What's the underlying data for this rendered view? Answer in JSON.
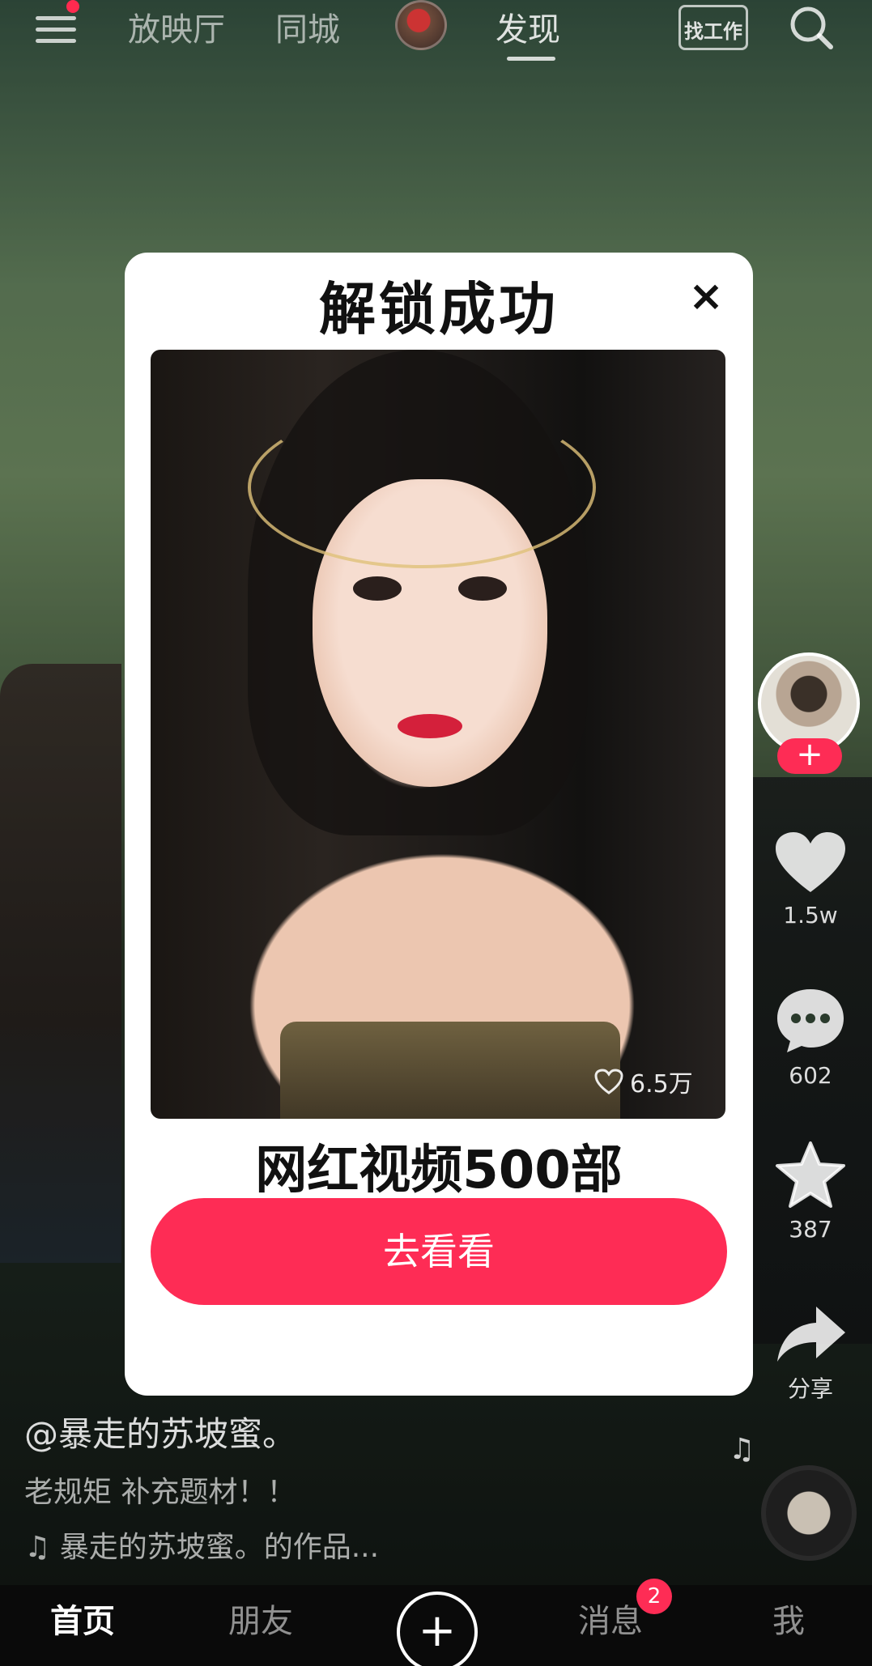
{
  "top_nav": {
    "tabs": [
      "放映厅",
      "同城",
      "发现"
    ],
    "active_tab": "发现",
    "job_label": "找工作"
  },
  "sidebar": {
    "like_count": "1.5w",
    "comment_count": "602",
    "favorite_count": "387",
    "share_label": "分享"
  },
  "video": {
    "author": "@暴走的苏坡蜜。",
    "description": "老规矩 补充题材！！",
    "music": "暴走的苏坡蜜。的作品..."
  },
  "modal": {
    "title": "解锁成功",
    "close_label": "×",
    "preview_likes": "6.5万",
    "offer_title": "网红视频500部",
    "cta_label": "去看看"
  },
  "tabbar": {
    "home": "首页",
    "friends": "朋友",
    "messages": "消息",
    "messages_badge": "2",
    "me": "我"
  },
  "colors": {
    "accent": "#fe2c55",
    "modal_bg": "#ffffff"
  }
}
